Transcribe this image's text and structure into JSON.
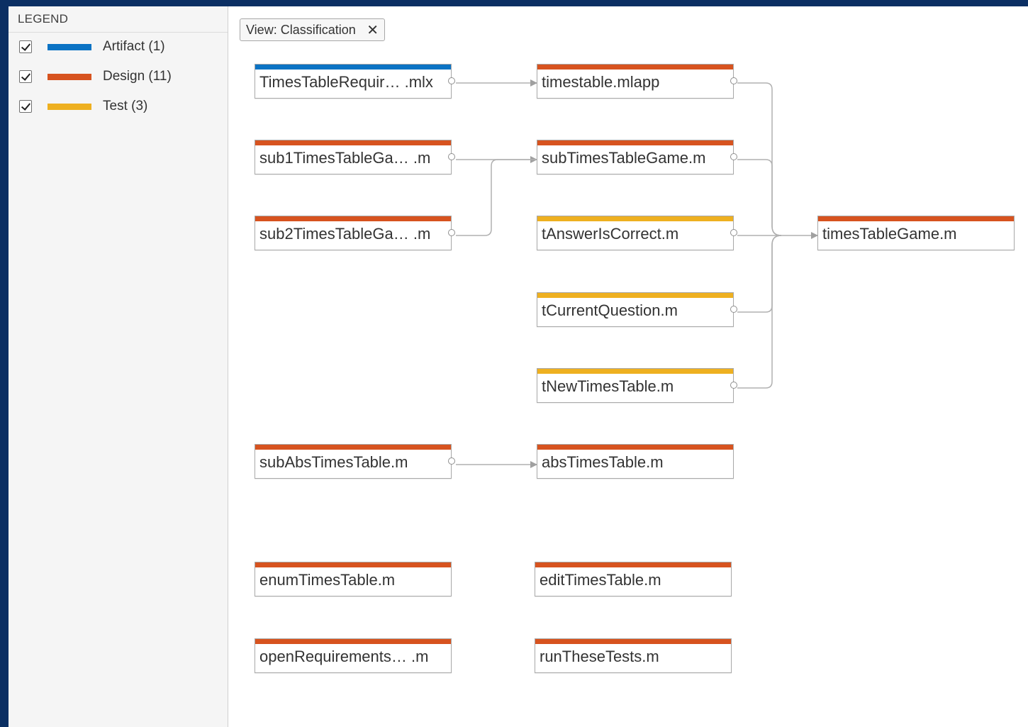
{
  "colors": {
    "artifact": "#0b73c4",
    "design": "#d7531f",
    "test": "#eeb020",
    "edge": "#b0b0b0"
  },
  "legend": {
    "title": "LEGEND",
    "items": [
      {
        "label": "Artifact (1)",
        "checked": true,
        "color": "#0b73c4"
      },
      {
        "label": "Design (11)",
        "checked": true,
        "color": "#d7531f"
      },
      {
        "label": "Test (3)",
        "checked": true,
        "color": "#eeb020"
      }
    ]
  },
  "view_chip": {
    "label": "View: Classification",
    "close_icon": "close-icon"
  },
  "nodes": [
    {
      "id": "n1",
      "label": "TimesTableRequir…  .mlx",
      "class": "artifact"
    },
    {
      "id": "n2",
      "label": "timestable.mlapp",
      "class": "design"
    },
    {
      "id": "n3",
      "label": "sub1TimesTableGa…  .m",
      "class": "design"
    },
    {
      "id": "n4",
      "label": "subTimesTableGame.m",
      "class": "design"
    },
    {
      "id": "n5",
      "label": "sub2TimesTableGa…  .m",
      "class": "design"
    },
    {
      "id": "n6",
      "label": "tAnswerIsCorrect.m",
      "class": "test"
    },
    {
      "id": "n7",
      "label": "timesTableGame.m",
      "class": "design"
    },
    {
      "id": "n8",
      "label": "tCurrentQuestion.m",
      "class": "test"
    },
    {
      "id": "n9",
      "label": "tNewTimesTable.m",
      "class": "test"
    },
    {
      "id": "n10",
      "label": "subAbsTimesTable.m",
      "class": "design"
    },
    {
      "id": "n11",
      "label": "absTimesTable.m",
      "class": "design"
    },
    {
      "id": "n12",
      "label": "enumTimesTable.m",
      "class": "design"
    },
    {
      "id": "n13",
      "label": "editTimesTable.m",
      "class": "design"
    },
    {
      "id": "n14",
      "label": "openRequirements…  .m",
      "class": "design"
    },
    {
      "id": "n15",
      "label": "runTheseTests.m",
      "class": "design"
    }
  ],
  "edges": [
    {
      "from": "n1",
      "to": "n2"
    },
    {
      "from": "n3",
      "to": "n4"
    },
    {
      "from": "n5",
      "to": "n4"
    },
    {
      "from": "n2",
      "to": "n7"
    },
    {
      "from": "n4",
      "to": "n7"
    },
    {
      "from": "n6",
      "to": "n7"
    },
    {
      "from": "n8",
      "to": "n7"
    },
    {
      "from": "n9",
      "to": "n7"
    },
    {
      "from": "n10",
      "to": "n11"
    }
  ]
}
